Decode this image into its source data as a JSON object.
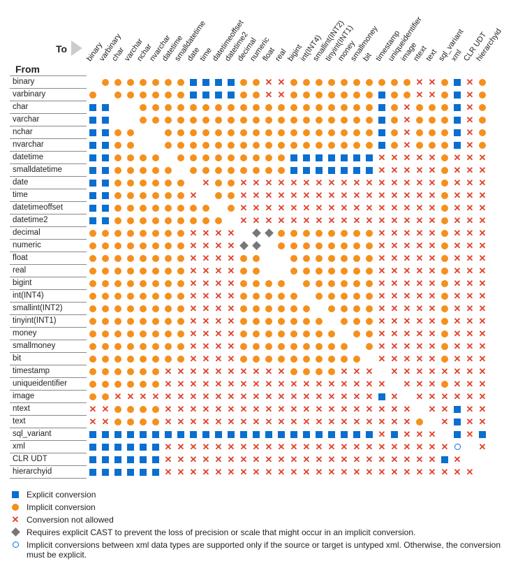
{
  "labels": {
    "from": "From",
    "to": "To"
  },
  "types": [
    "binary",
    "varbinary",
    "char",
    "varchar",
    "nchar",
    "nvarchar",
    "datetime",
    "smalldatetime",
    "date",
    "time",
    "datetimeoffset",
    "datetime2",
    "decimal",
    "numeric",
    "float",
    "real",
    "bigint",
    "int(INT4)",
    "smallint(INT2)",
    "tinyint(INT1)",
    "money",
    "smallmoney",
    "bit",
    "timestamp",
    "uniqueidentifier",
    "image",
    "ntext",
    "text",
    "sql_variant",
    "xml",
    "CLR UDT",
    "hierarchyid"
  ],
  "legend": [
    {
      "kind": "E",
      "text": "Explicit conversion"
    },
    {
      "kind": "I",
      "text": "Implicit conversion"
    },
    {
      "kind": "X",
      "text": "Conversion not allowed"
    },
    {
      "kind": "D",
      "text": "Requires explicit CAST to prevent the loss of precision or scale that might occur in an implicit conversion."
    },
    {
      "kind": "O",
      "text": "Implicit conversions between xml data types are supported only if the source or target is untyped xml. Otherwise, the conversion must be explicit."
    }
  ],
  "chart_data": {
    "type": "heatmap",
    "note": "Cell codes: E=explicit(blue square),I=implicit(orange dot),X=not allowed,D=diamond(explicit cast needed),O=open circle(xml special),blank=same type",
    "rows_from": "types",
    "cols_to": "types",
    "matrix": [
      [
        " ",
        "I",
        "I",
        "I",
        "I",
        "I",
        "I",
        "I",
        "E",
        "E",
        "E",
        "E",
        "I",
        "I",
        "X",
        "X",
        "I",
        "I",
        "I",
        "I",
        "I",
        "I",
        "I",
        "I",
        "I",
        "I",
        "X",
        "X",
        "I",
        "E",
        "X",
        "I",
        "I",
        "I"
      ],
      [
        "I",
        " ",
        "I",
        "I",
        "I",
        "I",
        "I",
        "I",
        "E",
        "E",
        "E",
        "E",
        "I",
        "I",
        "X",
        "X",
        "I",
        "I",
        "I",
        "I",
        "I",
        "I",
        "I",
        "E",
        "I",
        "I",
        "X",
        "X",
        "I",
        "E",
        "X",
        "I",
        "I",
        "I"
      ],
      [
        "E",
        "E",
        " ",
        " ",
        "I",
        "I",
        "I",
        "I",
        "I",
        "I",
        "I",
        "I",
        "I",
        "I",
        "I",
        "I",
        "I",
        "I",
        "I",
        "I",
        "I",
        "I",
        "I",
        "E",
        "I",
        "X",
        "I",
        "I",
        "I",
        "E",
        "X",
        "I",
        "I"
      ],
      [
        "E",
        "E",
        " ",
        " ",
        "I",
        "I",
        "I",
        "I",
        "I",
        "I",
        "I",
        "I",
        "I",
        "I",
        "I",
        "I",
        "I",
        "I",
        "I",
        "I",
        "I",
        "I",
        "I",
        "E",
        "I",
        "X",
        "I",
        "I",
        "I",
        "E",
        "X",
        "I",
        "I"
      ],
      [
        "E",
        "E",
        "I",
        "I",
        " ",
        " ",
        "I",
        "I",
        "I",
        "I",
        "I",
        "I",
        "I",
        "I",
        "I",
        "I",
        "I",
        "I",
        "I",
        "I",
        "I",
        "I",
        "I",
        "E",
        "I",
        "X",
        "I",
        "I",
        "I",
        "E",
        "X",
        "I",
        "I"
      ],
      [
        "E",
        "E",
        "I",
        "I",
        " ",
        " ",
        "I",
        "I",
        "I",
        "I",
        "I",
        "I",
        "I",
        "I",
        "I",
        "I",
        "I",
        "I",
        "I",
        "I",
        "I",
        "I",
        "I",
        "E",
        "I",
        "X",
        "I",
        "I",
        "I",
        "E",
        "X",
        "I",
        "I"
      ],
      [
        "E",
        "E",
        "I",
        "I",
        "I",
        "I",
        " ",
        "I",
        "I",
        "I",
        "I",
        "I",
        "I",
        "I",
        "I",
        "I",
        "E",
        "E",
        "E",
        "E",
        "E",
        "E",
        "E",
        "X",
        "X",
        "X",
        "X",
        "X",
        "I",
        "X",
        "X",
        "X",
        "X"
      ],
      [
        "E",
        "E",
        "I",
        "I",
        "I",
        "I",
        "I",
        " ",
        "I",
        "I",
        "I",
        "I",
        "I",
        "I",
        "I",
        "I",
        "E",
        "E",
        "E",
        "E",
        "E",
        "E",
        "E",
        "X",
        "X",
        "X",
        "X",
        "X",
        "I",
        "X",
        "X",
        "X",
        "X"
      ],
      [
        "E",
        "E",
        "I",
        "I",
        "I",
        "I",
        "I",
        "I",
        " ",
        "X",
        "I",
        "I",
        "X",
        "X",
        "X",
        "X",
        "X",
        "X",
        "X",
        "X",
        "X",
        "X",
        "X",
        "X",
        "X",
        "X",
        "X",
        "X",
        "I",
        "X",
        "X",
        "X",
        "X"
      ],
      [
        "E",
        "E",
        "I",
        "I",
        "I",
        "I",
        "I",
        "I",
        "X",
        " ",
        "I",
        "I",
        "X",
        "X",
        "X",
        "X",
        "X",
        "X",
        "X",
        "X",
        "X",
        "X",
        "X",
        "X",
        "X",
        "X",
        "X",
        "X",
        "I",
        "X",
        "X",
        "X",
        "X"
      ],
      [
        "E",
        "E",
        "I",
        "I",
        "I",
        "I",
        "I",
        "I",
        "I",
        "I",
        " ",
        "I",
        "X",
        "X",
        "X",
        "X",
        "X",
        "X",
        "X",
        "X",
        "X",
        "X",
        "X",
        "X",
        "X",
        "X",
        "X",
        "X",
        "I",
        "X",
        "X",
        "X",
        "X"
      ],
      [
        "E",
        "E",
        "I",
        "I",
        "I",
        "I",
        "I",
        "I",
        "I",
        "I",
        "I",
        " ",
        "X",
        "X",
        "X",
        "X",
        "X",
        "X",
        "X",
        "X",
        "X",
        "X",
        "X",
        "X",
        "X",
        "X",
        "X",
        "X",
        "I",
        "X",
        "X",
        "X",
        "X"
      ],
      [
        "I",
        "I",
        "I",
        "I",
        "I",
        "I",
        "I",
        "I",
        "X",
        "X",
        "X",
        "X",
        " ",
        "D",
        "D",
        "I",
        "I",
        "I",
        "I",
        "I",
        "I",
        "I",
        "I",
        "X",
        "X",
        "X",
        "X",
        "X",
        "I",
        "X",
        "X",
        "X",
        "X"
      ],
      [
        "I",
        "I",
        "I",
        "I",
        "I",
        "I",
        "I",
        "I",
        "X",
        "X",
        "X",
        "X",
        "D",
        "D",
        " ",
        "I",
        "I",
        "I",
        "I",
        "I",
        "I",
        "I",
        "I",
        "X",
        "X",
        "X",
        "X",
        "X",
        "I",
        "X",
        "X",
        "X",
        "X"
      ],
      [
        "I",
        "I",
        "I",
        "I",
        "I",
        "I",
        "I",
        "I",
        "X",
        "X",
        "X",
        "X",
        "I",
        "I",
        " ",
        " ",
        "I",
        "I",
        "I",
        "I",
        "I",
        "I",
        "I",
        "X",
        "X",
        "X",
        "X",
        "X",
        "I",
        "X",
        "X",
        "X",
        "X"
      ],
      [
        "I",
        "I",
        "I",
        "I",
        "I",
        "I",
        "I",
        "I",
        "X",
        "X",
        "X",
        "X",
        "I",
        "I",
        " ",
        " ",
        "I",
        "I",
        "I",
        "I",
        "I",
        "I",
        "I",
        "X",
        "X",
        "X",
        "X",
        "X",
        "I",
        "X",
        "X",
        "X",
        "X"
      ],
      [
        "I",
        "I",
        "I",
        "I",
        "I",
        "I",
        "I",
        "I",
        "X",
        "X",
        "X",
        "X",
        "I",
        "I",
        "I",
        "I",
        " ",
        "I",
        "I",
        "I",
        "I",
        "I",
        "I",
        "X",
        "X",
        "X",
        "X",
        "X",
        "I",
        "X",
        "X",
        "X",
        "X"
      ],
      [
        "I",
        "I",
        "I",
        "I",
        "I",
        "I",
        "I",
        "I",
        "X",
        "X",
        "X",
        "X",
        "I",
        "I",
        "I",
        "I",
        "I",
        " ",
        "I",
        "I",
        "I",
        "I",
        "I",
        "X",
        "X",
        "X",
        "X",
        "X",
        "I",
        "X",
        "X",
        "X",
        "X"
      ],
      [
        "I",
        "I",
        "I",
        "I",
        "I",
        "I",
        "I",
        "I",
        "X",
        "X",
        "X",
        "X",
        "I",
        "I",
        "I",
        "I",
        "I",
        "I",
        " ",
        "I",
        "I",
        "I",
        "I",
        "X",
        "X",
        "X",
        "X",
        "X",
        "I",
        "X",
        "X",
        "X",
        "X"
      ],
      [
        "I",
        "I",
        "I",
        "I",
        "I",
        "I",
        "I",
        "I",
        "X",
        "X",
        "X",
        "X",
        "I",
        "I",
        "I",
        "I",
        "I",
        "I",
        "I",
        " ",
        "I",
        "I",
        "I",
        "X",
        "X",
        "X",
        "X",
        "X",
        "I",
        "X",
        "X",
        "X",
        "X"
      ],
      [
        "I",
        "I",
        "I",
        "I",
        "I",
        "I",
        "I",
        "I",
        "X",
        "X",
        "X",
        "X",
        "I",
        "I",
        "I",
        "I",
        "I",
        "I",
        "I",
        "I",
        " ",
        "I",
        "I",
        "X",
        "X",
        "X",
        "X",
        "X",
        "I",
        "X",
        "X",
        "X",
        "X"
      ],
      [
        "I",
        "I",
        "I",
        "I",
        "I",
        "I",
        "I",
        "I",
        "X",
        "X",
        "X",
        "X",
        "I",
        "I",
        "I",
        "I",
        "I",
        "I",
        "I",
        "I",
        "I",
        " ",
        "I",
        "X",
        "X",
        "X",
        "X",
        "X",
        "I",
        "X",
        "X",
        "X",
        "X"
      ],
      [
        "I",
        "I",
        "I",
        "I",
        "I",
        "I",
        "I",
        "I",
        "X",
        "X",
        "X",
        "X",
        "I",
        "I",
        "I",
        "I",
        "I",
        "I",
        "I",
        "I",
        "I",
        "I",
        " ",
        "X",
        "X",
        "X",
        "X",
        "X",
        "I",
        "X",
        "X",
        "X",
        "X"
      ],
      [
        "I",
        "I",
        "I",
        "I",
        "I",
        "I",
        "X",
        "X",
        "X",
        "X",
        "X",
        "X",
        "X",
        "X",
        "X",
        "X",
        "I",
        "I",
        "I",
        "I",
        "X",
        "X",
        "X",
        " ",
        "X",
        "X",
        "X",
        "X",
        "X",
        "X",
        "X",
        "X",
        "X"
      ],
      [
        "I",
        "I",
        "I",
        "I",
        "I",
        "I",
        "X",
        "X",
        "X",
        "X",
        "X",
        "X",
        "X",
        "X",
        "X",
        "X",
        "X",
        "X",
        "X",
        "X",
        "X",
        "X",
        "X",
        "X",
        " ",
        "X",
        "X",
        "X",
        "I",
        "X",
        "X",
        "X",
        "X"
      ],
      [
        "I",
        "I",
        "X",
        "X",
        "X",
        "X",
        "X",
        "X",
        "X",
        "X",
        "X",
        "X",
        "X",
        "X",
        "X",
        "X",
        "X",
        "X",
        "X",
        "X",
        "X",
        "X",
        "X",
        "E",
        "X",
        " ",
        "X",
        "X",
        "X",
        "X",
        "X",
        "X",
        "X"
      ],
      [
        "X",
        "X",
        "I",
        "I",
        "I",
        "I",
        "X",
        "X",
        "X",
        "X",
        "X",
        "X",
        "X",
        "X",
        "X",
        "X",
        "X",
        "X",
        "X",
        "X",
        "X",
        "X",
        "X",
        "X",
        "X",
        "X",
        " ",
        "X",
        "X",
        "E",
        "X",
        "X",
        "X"
      ],
      [
        "X",
        "X",
        "I",
        "I",
        "I",
        "I",
        "X",
        "X",
        "X",
        "X",
        "X",
        "X",
        "X",
        "X",
        "X",
        "X",
        "X",
        "X",
        "X",
        "X",
        "X",
        "X",
        "X",
        "X",
        "X",
        "X",
        "I",
        " ",
        "X",
        "E",
        "X",
        "X",
        "X"
      ],
      [
        "E",
        "E",
        "E",
        "E",
        "E",
        "E",
        "E",
        "E",
        "E",
        "E",
        "E",
        "E",
        "E",
        "E",
        "E",
        "E",
        "E",
        "E",
        "E",
        "E",
        "E",
        "E",
        "E",
        "X",
        "E",
        "X",
        "X",
        "X",
        " ",
        "E",
        "X",
        "E",
        "X"
      ],
      [
        "E",
        "E",
        "E",
        "E",
        "E",
        "E",
        "X",
        "X",
        "X",
        "X",
        "X",
        "X",
        "X",
        "X",
        "X",
        "X",
        "X",
        "X",
        "X",
        "X",
        "X",
        "X",
        "X",
        "X",
        "X",
        "X",
        "X",
        "X",
        "X",
        "O",
        " ",
        "X",
        "X"
      ],
      [
        "E",
        "E",
        "E",
        "E",
        "E",
        "E",
        "X",
        "X",
        "X",
        "X",
        "X",
        "X",
        "X",
        "X",
        "X",
        "X",
        "X",
        "X",
        "X",
        "X",
        "X",
        "X",
        "X",
        "X",
        "X",
        "X",
        "X",
        "X",
        "E",
        "X",
        " ",
        " ",
        "X"
      ],
      [
        "E",
        "E",
        "E",
        "E",
        "E",
        "E",
        "X",
        "X",
        "X",
        "X",
        "X",
        "X",
        "X",
        "X",
        "X",
        "X",
        "X",
        "X",
        "X",
        "X",
        "X",
        "X",
        "X",
        "X",
        "X",
        "X",
        "X",
        "X",
        "X",
        "X",
        "X",
        " ",
        " "
      ]
    ]
  }
}
